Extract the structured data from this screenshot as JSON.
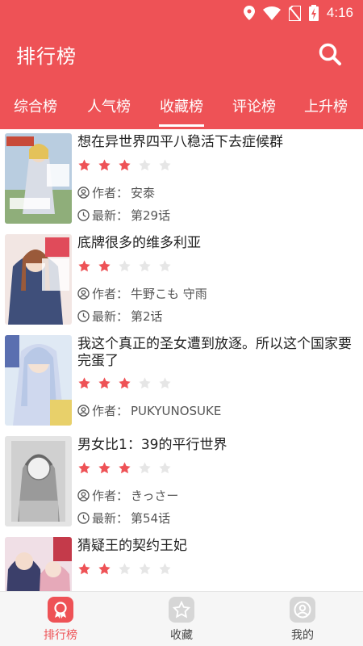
{
  "status_bar": {
    "time": "4:16"
  },
  "header": {
    "title": "排行榜"
  },
  "tabs": [
    {
      "label": "综合榜"
    },
    {
      "label": "人气榜"
    },
    {
      "label": "收藏榜"
    },
    {
      "label": "评论榜"
    },
    {
      "label": "上升榜"
    }
  ],
  "active_tab": "收藏榜",
  "items": [
    {
      "title": "想在异世界四平八稳活下去症候群",
      "rating": 3,
      "author_label": "作者：",
      "author": "安泰",
      "latest_label": "最新：",
      "latest": "第29话"
    },
    {
      "title": "底牌很多的维多利亚",
      "rating": 2,
      "author_label": "作者：",
      "author": "牛野こも 守雨",
      "latest_label": "最新：",
      "latest": "第2话"
    },
    {
      "title": "我这个真正的圣女遭到放逐。所以这个国家要完蛋了",
      "rating": 3,
      "author_label": "作者：",
      "author": "PUKYUNOSUKE"
    },
    {
      "title": "男女比1：39的平行世界",
      "rating": 3,
      "author_label": "作者：",
      "author": "きっさー",
      "latest_label": "最新：",
      "latest": "第54话"
    },
    {
      "title": "猜疑王的契约王妃",
      "rating": 2
    }
  ],
  "bottom_nav": [
    {
      "label": "排行榜",
      "icon": "ranking-icon",
      "active": true
    },
    {
      "label": "收藏",
      "icon": "star-icon",
      "active": false
    },
    {
      "label": "我的",
      "icon": "user-icon",
      "active": false
    }
  ],
  "colors": {
    "primary": "#ee5256",
    "star_on": "#ee5256",
    "star_off": "#e6e6e6"
  }
}
